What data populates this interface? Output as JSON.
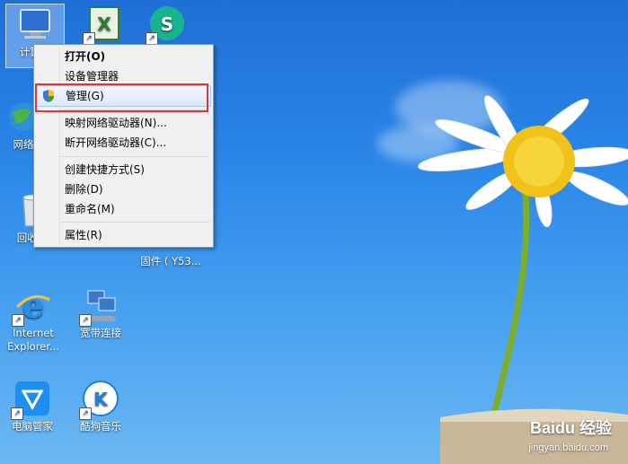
{
  "desktop": {
    "icons": [
      {
        "label": "计算机"
      },
      {
        "label": ""
      },
      {
        "label": ""
      },
      {
        "label": "网络"
      },
      {
        "label": "回收站"
      },
      {
        "label": "固件 ( Y53..."
      },
      {
        "label": "Internet Explorer..."
      },
      {
        "label": "宽带连接"
      },
      {
        "label": "电脑管家"
      },
      {
        "label": "酷狗音乐"
      }
    ]
  },
  "context_menu": {
    "items": [
      {
        "label": "打开(O)"
      },
      {
        "label": "设备管理器"
      },
      {
        "label": "管理(G)"
      },
      {
        "label": "映射网络驱动器(N)..."
      },
      {
        "label": "断开网络驱动器(C)..."
      },
      {
        "label": "创建快捷方式(S)"
      },
      {
        "label": "删除(D)"
      },
      {
        "label": "重命名(M)"
      },
      {
        "label": "属性(R)"
      }
    ]
  },
  "watermark": {
    "brand": "Baidu 经验",
    "url": "jingyan.baidu.com"
  },
  "colors": {
    "annotation": "#e53235",
    "sky_top": "#1f6fd6",
    "sky_bottom": "#6cb8f3"
  }
}
